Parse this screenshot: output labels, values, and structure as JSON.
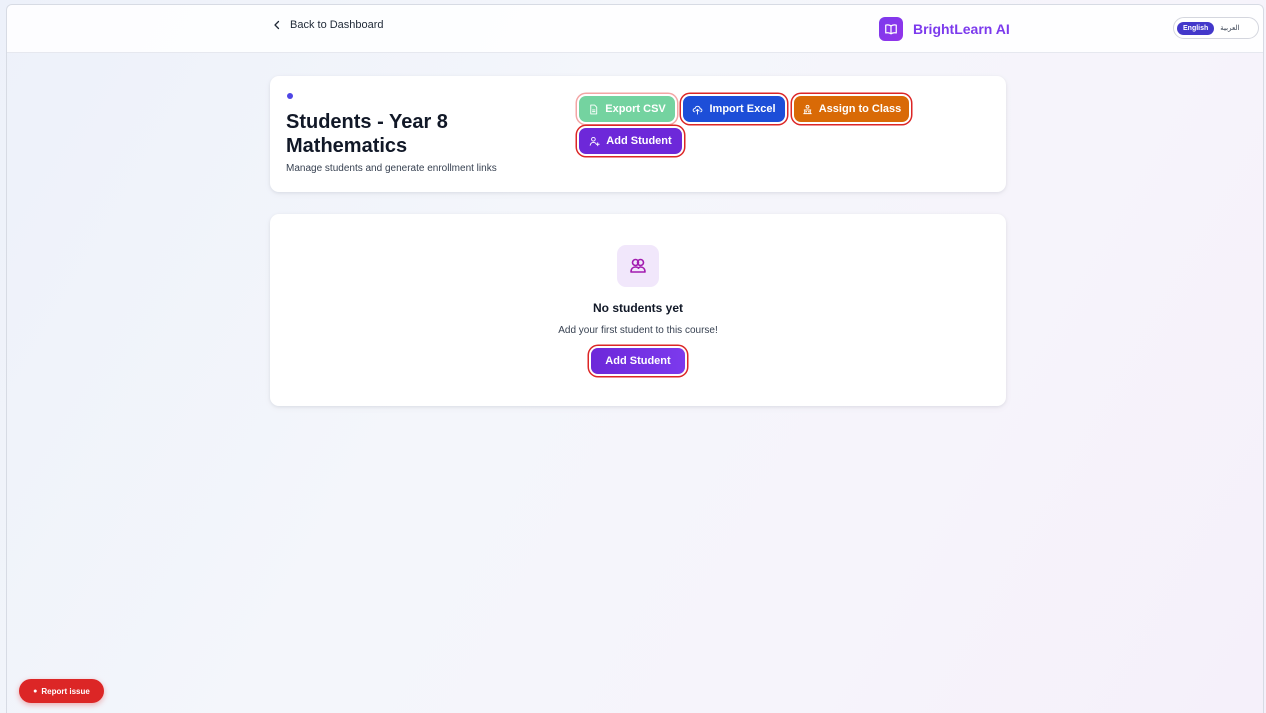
{
  "nav": {
    "back_label": "Back to Dashboard",
    "brand_name": "BrightLearn AI",
    "lang_english": "English",
    "lang_arabic": "العربية"
  },
  "header": {
    "title": "Students - Year 8 Mathematics",
    "subtitle": "Manage students and generate enrollment links",
    "buttons": {
      "export_csv": "Export CSV",
      "import_excel": "Import Excel",
      "assign_to_class": "Assign to Class",
      "add_student": "Add Student"
    }
  },
  "empty_state": {
    "title": "No students yet",
    "message": "Add your first student to this course!",
    "button": "Add Student"
  },
  "report": {
    "label": "Report issue"
  },
  "colors": {
    "brand": "#7c3aed",
    "export": "#74d3a0",
    "import": "#1d4ed8",
    "assign": "#d96a06",
    "add": "#6d28d9",
    "report": "#dc2626"
  },
  "icons": {
    "back": "chevron-left-icon",
    "brand": "book-open-icon",
    "export": "file-icon",
    "import": "cloud-upload-icon",
    "assign": "classroom-icon",
    "add": "user-plus-icon",
    "empty": "users-icon",
    "report": "bug-icon"
  }
}
